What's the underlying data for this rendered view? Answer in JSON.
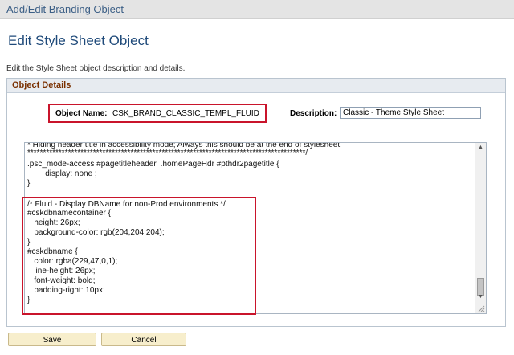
{
  "header": {
    "title": "Add/Edit Branding Object"
  },
  "page": {
    "title": "Edit Style Sheet Object",
    "description": "Edit the Style Sheet object description and details."
  },
  "details": {
    "group_title": "Object Details",
    "object_name_label": "Object Name:",
    "object_name_value": "CSK_BRAND_CLASSIC_TEMPL_FLUID",
    "description_label": "Description:",
    "description_value": "Classic - Theme Style Sheet"
  },
  "stylesheet": {
    "lines": [
      "* Hiding header title in accessibility mode; Always this should be at the end of stylesheet",
      "*****************************************************************************************/",
      ".psc_mode-access #pagetitleheader, .homePageHdr #pthdr2pagetitle {",
      "        display: none ;",
      "}",
      "",
      "/* Fluid - Display DBName for non-Prod environments */",
      "#cskdbnamecontainer {",
      "   height: 26px;",
      "   background-color: rgb(204,204,204);",
      "}",
      "#cskdbname {",
      "   color: rgba(229,47,0,1);",
      "   line-height: 26px;",
      "   font-weight: bold;",
      "   padding-right: 10px;",
      "}"
    ]
  },
  "buttons": {
    "save": "Save",
    "cancel": "Cancel"
  },
  "colors": {
    "highlight": "#c9142b",
    "title": "#1f4a7a",
    "group_title": "#7a3000",
    "button_bg": "#f7eecc"
  }
}
